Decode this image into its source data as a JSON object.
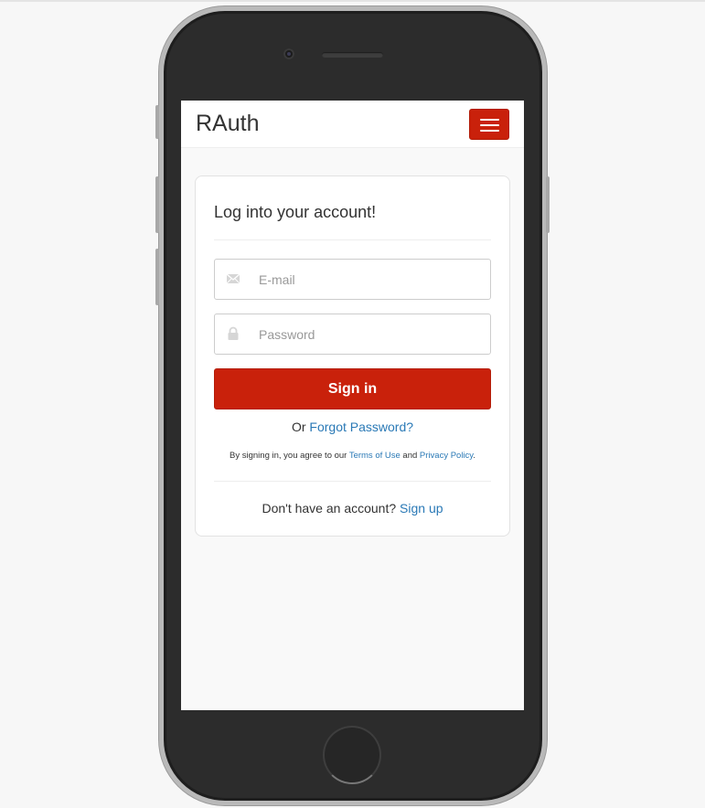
{
  "navbar": {
    "brand": "RAuth",
    "menu_icon": "hamburger-menu-icon",
    "accent_color": "#c9210b"
  },
  "login": {
    "title": "Log into your account!",
    "email": {
      "placeholder": "E-mail",
      "value": "",
      "icon": "envelope-icon"
    },
    "password": {
      "placeholder": "Password",
      "value": "",
      "icon": "lock-icon"
    },
    "signin_label": "Sign in",
    "forgot_prefix": "Or ",
    "forgot_link": "Forgot Password?",
    "terms_prefix": "By signing in, you agree to our ",
    "terms_link": "Terms of Use",
    "terms_and": " and ",
    "privacy_link": "Privacy Policy",
    "terms_suffix": ".",
    "signup_prefix": "Don't have an account? ",
    "signup_link": "Sign up"
  },
  "colors": {
    "primary": "#c9210b",
    "link": "#2a79b6",
    "text": "#333333"
  }
}
